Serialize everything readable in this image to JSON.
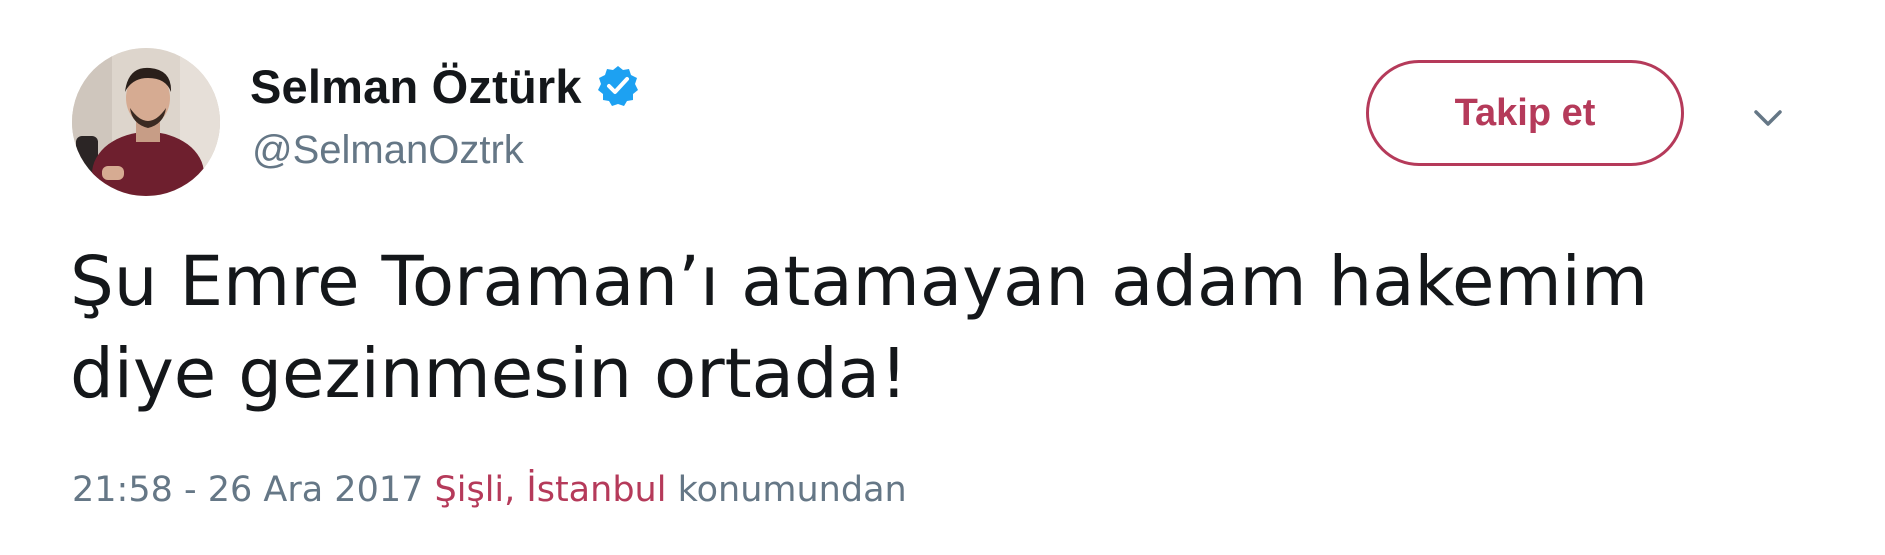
{
  "user": {
    "display_name": "Selman Öztürk",
    "handle": "@SelmanOztrk",
    "verified_icon": "verified-badge-icon",
    "avatar_icon": "user-avatar"
  },
  "actions": {
    "follow_label": "Takip et",
    "more_icon": "chevron-down-icon"
  },
  "tweet": {
    "text_lines": [
      "Şu Emre Toraman’ı atamayan adam hakemim",
      "diye gezinmesin ortada!"
    ]
  },
  "meta": {
    "timestamp": "21:58 - 26 Ara 2017",
    "location": "Şişli, İstanbul",
    "location_suffix": "konumundan"
  },
  "colors": {
    "accent": "#b53a5a",
    "verified": "#1da1f2",
    "text": "#14171a",
    "secondary": "#657786"
  }
}
